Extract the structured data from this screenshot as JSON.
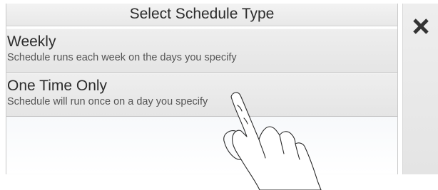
{
  "dialog": {
    "title": "Select Schedule Type",
    "options": [
      {
        "title": "Weekly",
        "description": "Schedule runs each week on the days you specify"
      },
      {
        "title": "One Time Only",
        "description": "Schedule will run once on a day you specify"
      }
    ]
  },
  "close_button": {
    "icon": "close-icon"
  },
  "overlay": {
    "icon": "pointing-hand-icon"
  },
  "colors": {
    "title_bar": "#ececec",
    "option_bg": "#e9e9e9",
    "close_column_bg": "#e8e8e8",
    "close_icon": "#333333"
  }
}
